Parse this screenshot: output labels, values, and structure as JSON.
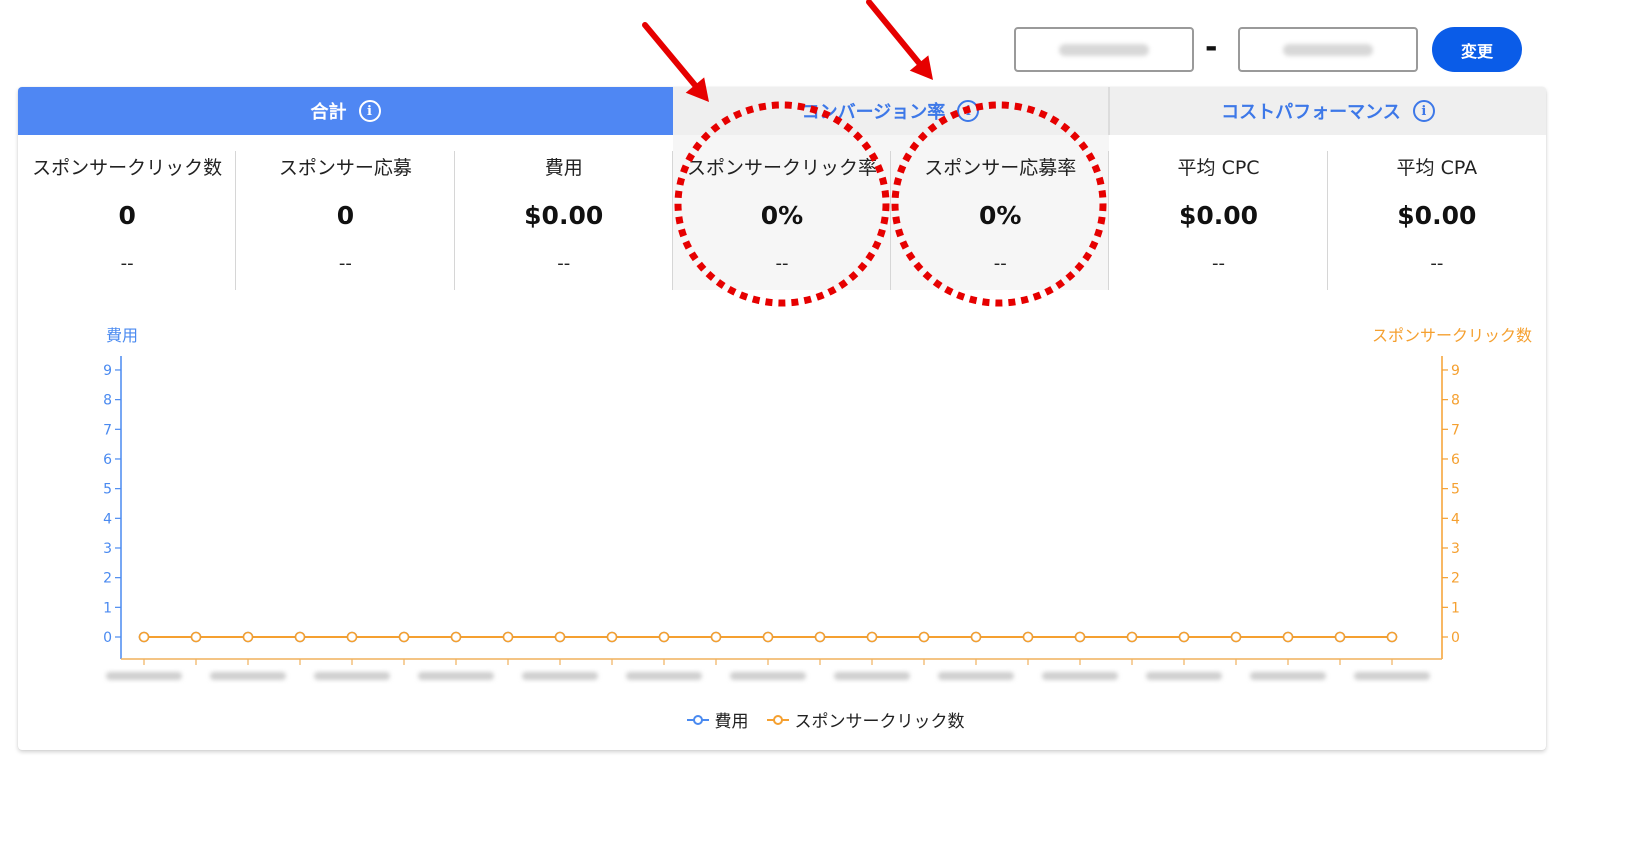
{
  "date_range": {
    "separator": "-",
    "apply_label": "変更"
  },
  "tabs": [
    {
      "label": "合計"
    },
    {
      "label": "コンバージョン率"
    },
    {
      "label": "コストパフォーマンス"
    }
  ],
  "metrics": [
    {
      "label": "スポンサークリック数",
      "value": "0",
      "delta": "--"
    },
    {
      "label": "スポンサー応募",
      "value": "0",
      "delta": "--"
    },
    {
      "label": "費用",
      "value": "$0.00",
      "delta": "--"
    },
    {
      "label": "スポンサークリック率",
      "value": "0%",
      "delta": "--"
    },
    {
      "label": "スポンサー応募率",
      "value": "0%",
      "delta": "--"
    },
    {
      "label": "平均 CPC",
      "value": "$0.00",
      "delta": "--"
    },
    {
      "label": "平均 CPA",
      "value": "$0.00",
      "delta": "--"
    }
  ],
  "colors": {
    "active_tab": "#4f87f3",
    "tab_text": "#3d78e8",
    "button": "#0a5ce8",
    "left_axis": "#4a8af0",
    "right_axis": "#f5a030",
    "annotation": "#e60000"
  },
  "chart_data": {
    "type": "line",
    "left_axis_label": "費用",
    "right_axis_label": "スポンサークリック数",
    "ylim": [
      0,
      9
    ],
    "y_ticks": [
      0,
      1,
      2,
      3,
      4,
      5,
      6,
      7,
      8,
      9
    ],
    "point_count": 25,
    "series": [
      {
        "name": "費用",
        "axis": "left",
        "values": [
          0,
          0,
          0,
          0,
          0,
          0,
          0,
          0,
          0,
          0,
          0,
          0,
          0,
          0,
          0,
          0,
          0,
          0,
          0,
          0,
          0,
          0,
          0,
          0,
          0
        ]
      },
      {
        "name": "スポンサークリック数",
        "axis": "right",
        "values": [
          0,
          0,
          0,
          0,
          0,
          0,
          0,
          0,
          0,
          0,
          0,
          0,
          0,
          0,
          0,
          0,
          0,
          0,
          0,
          0,
          0,
          0,
          0,
          0,
          0
        ]
      }
    ]
  }
}
